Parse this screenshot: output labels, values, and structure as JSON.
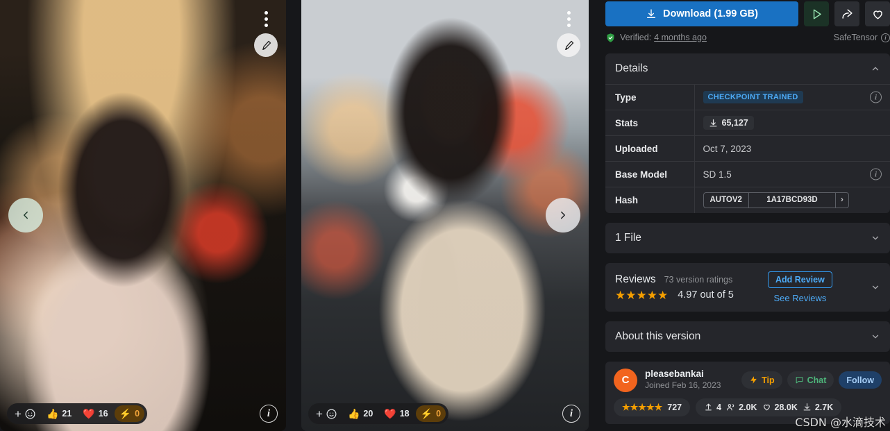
{
  "gallery": {
    "prev_arrow_icon": "chevron-left-icon",
    "next_arrow_icon": "chevron-right-icon",
    "images": [
      {
        "menu_icon": "kebab-menu-icon",
        "remix_icon": "paintbrush-icon",
        "info_icon": "info-icon",
        "add_reaction_label": "+",
        "reactions": [
          {
            "emoji": "👍",
            "count": "21",
            "name": "thumbs-up"
          },
          {
            "emoji": "❤️",
            "count": "16",
            "name": "heart"
          },
          {
            "emoji": "⚡",
            "count": "0",
            "name": "boost"
          }
        ]
      },
      {
        "menu_icon": "kebab-menu-icon",
        "remix_icon": "paintbrush-icon",
        "info_icon": "info-icon",
        "add_reaction_label": "+",
        "reactions": [
          {
            "emoji": "👍",
            "count": "20",
            "name": "thumbs-up"
          },
          {
            "emoji": "❤️",
            "count": "18",
            "name": "heart"
          },
          {
            "emoji": "⚡",
            "count": "0",
            "name": "boost"
          }
        ]
      }
    ]
  },
  "actions": {
    "download_label": "Download (1.99 GB)",
    "download_icon": "download-icon",
    "play_icon": "play-icon",
    "share_icon": "share-icon",
    "favorite_icon": "heart-outline-icon",
    "verified_prefix": "Verified:",
    "verified_time": "4 months ago",
    "safetensor_label": "SafeTensor",
    "accent_blue": "#1971c2"
  },
  "details": {
    "title": "Details",
    "rows": [
      {
        "key": "Type",
        "value": "CHECKPOINT TRAINED",
        "kind": "tag",
        "info": true
      },
      {
        "key": "Stats",
        "value": "65,127",
        "kind": "stat",
        "info": false
      },
      {
        "key": "Uploaded",
        "value": "Oct 7, 2023",
        "kind": "text",
        "info": false
      },
      {
        "key": "Base Model",
        "value": "SD 1.5",
        "kind": "text",
        "info": true
      },
      {
        "key": "Hash",
        "value": "1A17BCD93D",
        "kind": "hash",
        "algo": "AUTOV2",
        "info": false
      }
    ]
  },
  "files": {
    "title": "1 File"
  },
  "reviews": {
    "title": "Reviews",
    "version_ratings": "73 version ratings",
    "score_text": "4.97 out of 5",
    "stars": 5,
    "add_review_label": "Add Review",
    "see_reviews_label": "See Reviews"
  },
  "about": {
    "title": "About this version"
  },
  "creator": {
    "avatar_letter": "C",
    "name": "pleasebankai",
    "joined": "Joined Feb 16, 2023",
    "tip_label": "Tip",
    "chat_label": "Chat",
    "follow_label": "Follow",
    "rating_count": "727",
    "stars": 5,
    "uploads": "4",
    "followers": "2.0K",
    "likes": "28.0K",
    "downloads": "2.7K",
    "upload_icon": "upload-icon",
    "followers_icon": "users-icon",
    "likes_icon": "heart-outline-icon",
    "downloads_icon": "download-icon"
  },
  "watermark": {
    "text": "CSDN @水滴技术"
  }
}
